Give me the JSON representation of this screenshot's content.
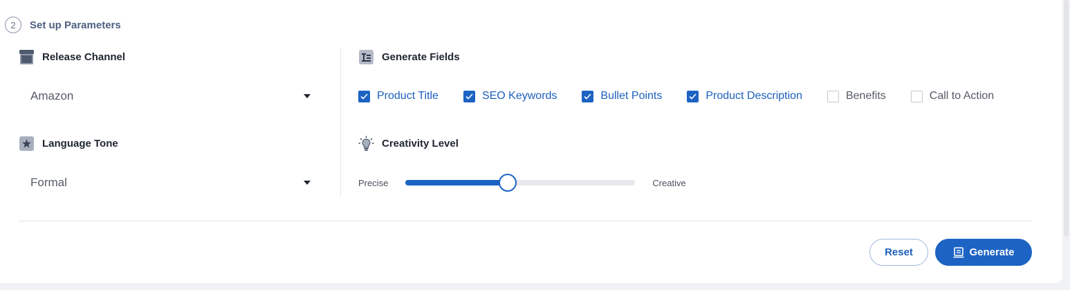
{
  "step": {
    "number": "2",
    "title": "Set up Parameters"
  },
  "release_channel": {
    "label": "Release Channel",
    "icon": "storefront-icon",
    "selected": "Amazon"
  },
  "language_tone": {
    "label": "Language Tone",
    "icon": "star-icon",
    "selected": "Formal"
  },
  "generate_fields": {
    "label": "Generate Fields",
    "icon": "text-fields-icon",
    "options": [
      {
        "label": "Product Title",
        "checked": true
      },
      {
        "label": "SEO Keywords",
        "checked": true
      },
      {
        "label": "Bullet Points",
        "checked": true
      },
      {
        "label": "Product Description",
        "checked": true
      },
      {
        "label": "Benefits",
        "checked": false
      },
      {
        "label": "Call to Action",
        "checked": false
      }
    ]
  },
  "creativity": {
    "label": "Creativity Level",
    "icon": "lightbulb-icon",
    "min_label": "Precise",
    "max_label": "Creative",
    "value_fraction": 0.445
  },
  "actions": {
    "reset_label": "Reset",
    "generate_label": "Generate"
  },
  "colors": {
    "accent": "#1c63c4",
    "title_text": "#1f2530",
    "step_title": "#4d5f80"
  }
}
